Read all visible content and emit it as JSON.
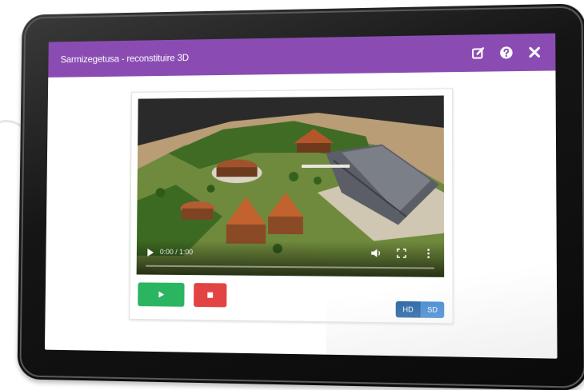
{
  "app": {
    "title": "Sarmizegetusa - reconstituire 3D",
    "header_color": "#8a4cb2",
    "icons": [
      "edit-icon",
      "help-icon",
      "close-icon"
    ]
  },
  "video": {
    "time_display": "0:00 / 1:00",
    "progress_fraction": 0.0,
    "controls": [
      "play-icon",
      "volume-icon",
      "fullscreen-icon",
      "more-options-icon"
    ]
  },
  "actions": {
    "play_color": "#2bb560",
    "stop_color": "#e14443"
  },
  "quality": {
    "options": [
      "HD",
      "SD"
    ],
    "color": "#1e5fa3"
  }
}
